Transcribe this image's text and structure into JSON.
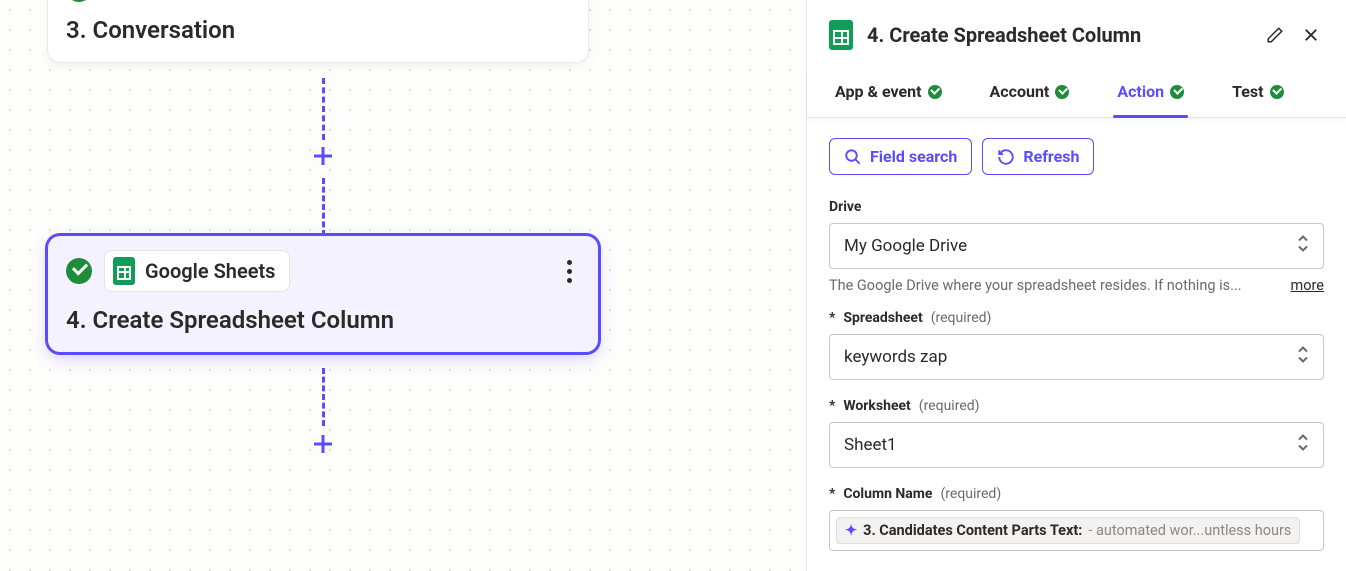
{
  "canvas": {
    "node3": {
      "number": "3.",
      "title": "Conversation"
    },
    "node4": {
      "number": "4.",
      "app_name": "Google Sheets",
      "title": "Create Spreadsheet Column"
    }
  },
  "sidebar": {
    "header": {
      "number": "4.",
      "title": "Create Spreadsheet Column"
    },
    "tabs": {
      "app_event": "App & event",
      "account": "Account",
      "action": "Action",
      "test": "Test"
    },
    "buttons": {
      "field_search": "Field search",
      "refresh": "Refresh"
    },
    "fields": {
      "drive": {
        "label": "Drive",
        "value": "My Google Drive",
        "helper": "The Google Drive where your spreadsheet resides. If nothing is...",
        "more": "more"
      },
      "spreadsheet": {
        "label": "Spreadsheet",
        "required": "(required)",
        "value": "keywords zap"
      },
      "worksheet": {
        "label": "Worksheet",
        "required": "(required)",
        "value": "Sheet1"
      },
      "column_name": {
        "label": "Column Name",
        "required": "(required)",
        "pill_source": "3. Candidates Content Parts Text:",
        "pill_value": "- automated wor...untless hours"
      }
    },
    "asterisk": "*"
  }
}
